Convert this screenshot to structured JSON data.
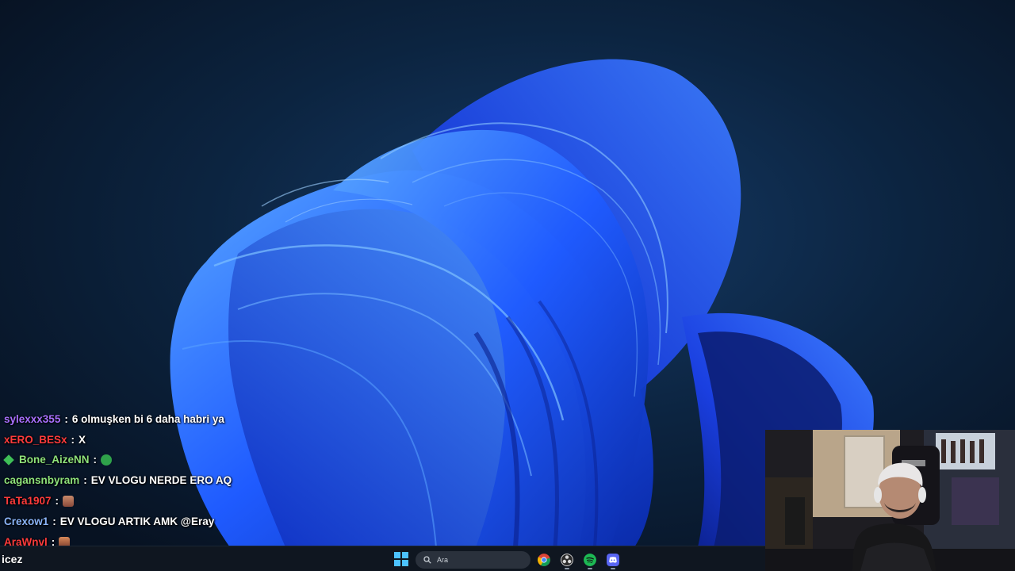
{
  "chat": {
    "messages": [
      {
        "user": "sylexxx355",
        "color": "#a970ff",
        "text": "6 olmuşken bi 6 daha habri ya",
        "emote": ""
      },
      {
        "user": "xERO_BESx",
        "color": "#ff3b3b",
        "text": "X",
        "emote": ""
      },
      {
        "user": "Bone_AizeNN",
        "color": "#8fe27a",
        "text": "",
        "emote": "green-emote",
        "badge": "green-diamond-badge"
      },
      {
        "user": "cagansnbyram",
        "color": "#8fe27a",
        "text": "EV VLOGU NERDE ERO AQ",
        "emote": ""
      },
      {
        "user": "TaTa1907",
        "color": "#ff3b3b",
        "text": "",
        "emote": "hand-emote"
      },
      {
        "user": "Crexow1",
        "color": "#8ab4f8",
        "text": "EV VLOGU ARTIK AMK @Eray",
        "emote": ""
      },
      {
        "user": "AraWnvl",
        "color": "#ff3b3b",
        "text": "",
        "emote": "face-emote"
      }
    ]
  },
  "bottom_bar": {
    "text": "icez"
  },
  "taskbar": {
    "search_placeholder": "Ara",
    "icons": [
      "windows-start-icon",
      "search-icon",
      "chrome-icon",
      "obs-icon",
      "spotify-icon",
      "discord-icon"
    ]
  },
  "colors": {
    "wallpaper_background": "#0a1a2c",
    "bloom_blue": "#1f5bff",
    "accent": "#4cc2ff"
  }
}
